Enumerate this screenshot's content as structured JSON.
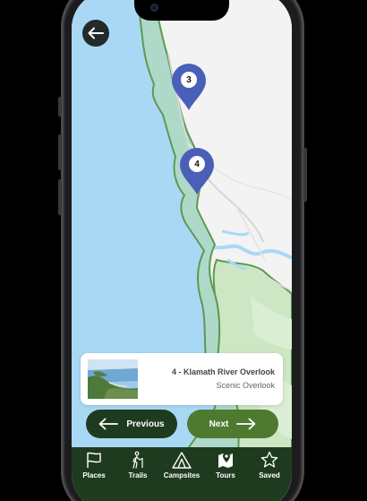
{
  "map": {
    "markers": [
      {
        "number": "3"
      },
      {
        "number": "4"
      }
    ]
  },
  "info_card": {
    "title": "4 - Klamath River Overlook",
    "subtitle": "Scenic Overlook"
  },
  "navigation": {
    "previous_label": "Previous",
    "next_label": "Next"
  },
  "tabs": [
    {
      "label": "Places",
      "icon": "flag-icon"
    },
    {
      "label": "Trails",
      "icon": "hiker-icon"
    },
    {
      "label": "Campsites",
      "icon": "tent-icon"
    },
    {
      "label": "Tours",
      "icon": "map-pin-icon"
    },
    {
      "label": "Saved",
      "icon": "star-icon"
    }
  ],
  "colors": {
    "water": "#a9d8f5",
    "land": "#f3f3f3",
    "park": "#cde6c4",
    "park_border": "#5d9a52",
    "marker": "#4a5fb8",
    "dark_green": "#1f3b1f",
    "accent_green": "#4e7a30"
  }
}
